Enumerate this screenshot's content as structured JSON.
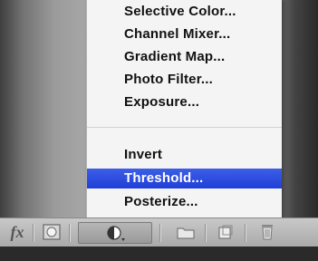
{
  "menu": {
    "items": [
      {
        "label": "Selective Color..."
      },
      {
        "label": "Channel Mixer..."
      },
      {
        "label": "Gradient Map..."
      },
      {
        "label": "Photo Filter..."
      },
      {
        "label": "Exposure..."
      },
      {
        "label": "Invert"
      },
      {
        "label": "Threshold..."
      },
      {
        "label": "Posterize..."
      }
    ],
    "selected": "Threshold...",
    "selection_color": "#2a4adf"
  },
  "toolbar": {
    "fx_label": "fx",
    "icons": [
      "fx-icon",
      "layer-mask-icon",
      "adjustment-layer-icon",
      "folder-icon",
      "new-layer-icon",
      "trash-icon"
    ]
  }
}
